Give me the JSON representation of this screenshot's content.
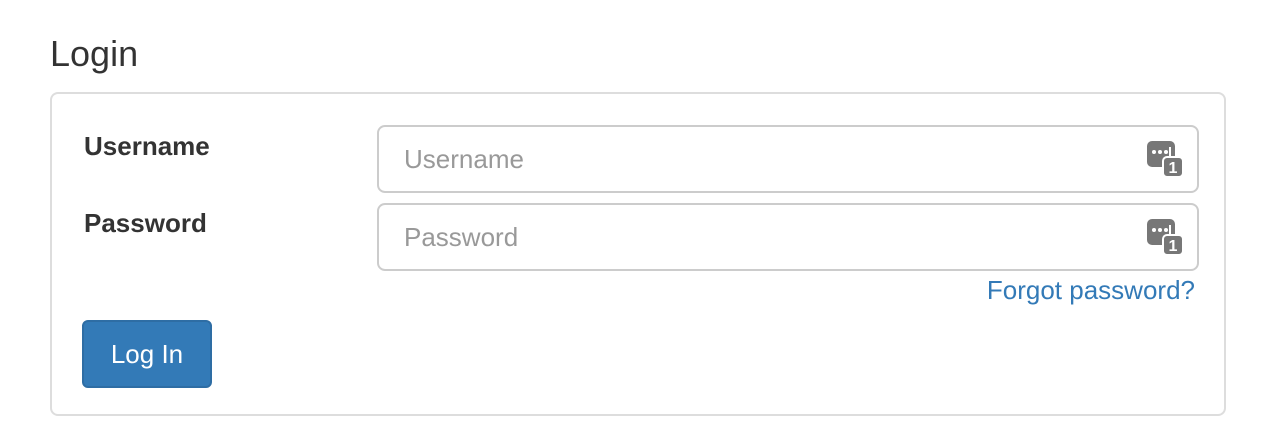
{
  "page": {
    "title": "Login"
  },
  "form": {
    "username": {
      "label": "Username",
      "placeholder": "Username",
      "value": "",
      "icon": "password-manager-icon"
    },
    "password": {
      "label": "Password",
      "placeholder": "Password",
      "value": "",
      "icon": "password-manager-icon"
    },
    "forgot_password_link": "Forgot password?",
    "submit_label": "Log In"
  },
  "colors": {
    "primary": "#337ab7",
    "link": "#337ab7",
    "border": "#cccccc",
    "panel_border": "#dddddd",
    "text": "#333333",
    "placeholder": "#999999"
  }
}
